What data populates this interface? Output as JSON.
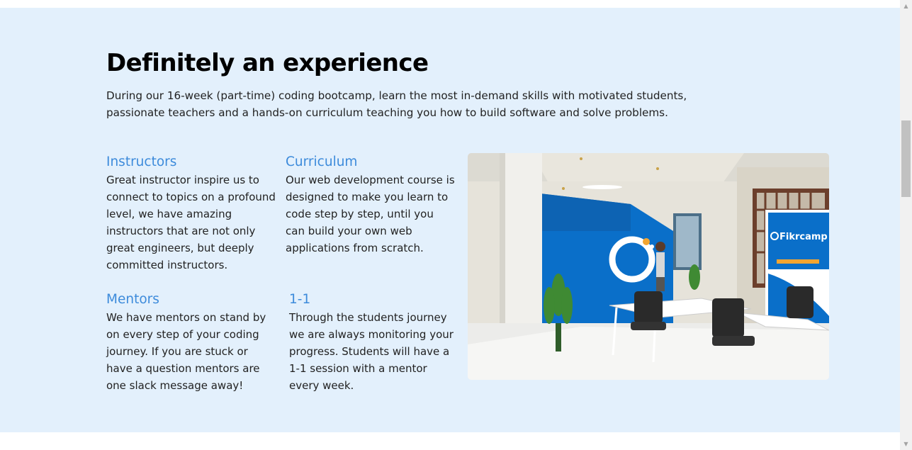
{
  "experience": {
    "title": "Definitely an experience",
    "intro": "During our 16-week (part-time) coding bootcamp, learn the most in-demand skills with motivated students, passionate teachers and a hands-on curriculum teaching you how to build software and solve problems.",
    "features": [
      {
        "title": "Instructors",
        "text": "Great instructor inspire us to connect to topics on a profound level, we have amazing instructors that are not only great engineers, but deeply committed instructors."
      },
      {
        "title": "Curriculum",
        "text": "Our web development course is designed to make you learn to code step by step, until you can build your own web applications from scratch."
      },
      {
        "title": "Mentors",
        "text": "We have mentors on stand by on every step of your coding journey. If you are stuck or have a question mentors are one slack message away!"
      },
      {
        "title": "1-1",
        "text": "Through the students journey we are always monitoring your progress. Students will have a 1-1 session with a mentor every week."
      }
    ],
    "photo": {
      "banner_brand": "Fikrcamp",
      "accent_blue": "#0a6fc9",
      "banner_orange": "#f2a531"
    }
  },
  "colors": {
    "section_background": "#e3f0fc",
    "feature_title": "#3d8bdb"
  }
}
